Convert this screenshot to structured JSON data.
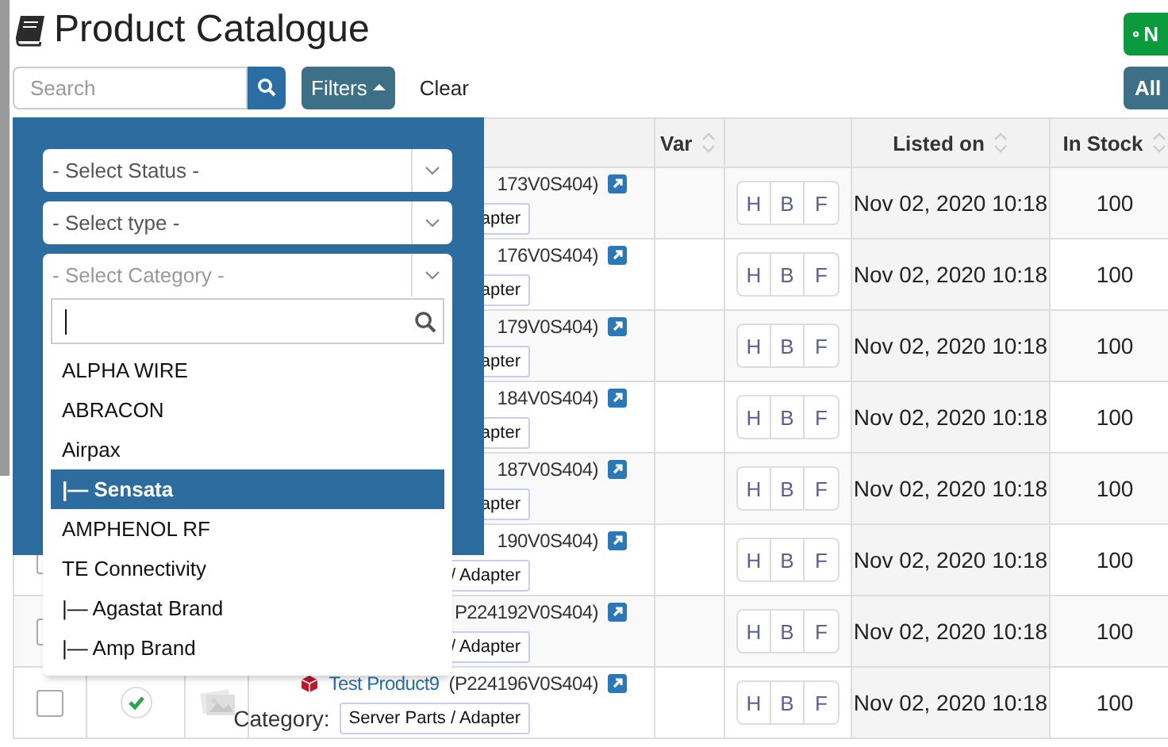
{
  "title": "Product Catalogue",
  "new_button": "N",
  "search": {
    "placeholder": "Search"
  },
  "filters_button": {
    "label": "Filters",
    "expanded": true
  },
  "clear_link": "Clear",
  "all_button": "All",
  "filter_panel": {
    "selects": [
      {
        "placeholder": "- Select Status -",
        "open": false
      },
      {
        "placeholder": "- Select type -",
        "open": false
      },
      {
        "placeholder": "- Select Category -",
        "open": true
      }
    ],
    "options": [
      {
        "label": "ALPHA WIRE",
        "selected": false
      },
      {
        "label": "ABRACON",
        "selected": false
      },
      {
        "label": "Airpax",
        "selected": false
      },
      {
        "label": "|— Sensata",
        "selected": true
      },
      {
        "label": "AMPHENOL RF",
        "selected": false
      },
      {
        "label": "TE Connectivity",
        "selected": false
      },
      {
        "label": "|— Agastat Brand",
        "selected": false
      },
      {
        "label": "|— Amp Brand",
        "selected": false
      }
    ]
  },
  "table": {
    "header": {
      "var": "Var",
      "listed_on": "Listed on",
      "in_stock": "In Stock"
    },
    "rows": [
      {
        "code": "173V0S404)",
        "category": "apter",
        "hbf": [
          "H",
          "B",
          "F"
        ],
        "listed_on": "Nov 02, 2020 10:18",
        "in_stock": "100"
      },
      {
        "code": "176V0S404)",
        "category": "apter",
        "hbf": [
          "H",
          "B",
          "F"
        ],
        "listed_on": "Nov 02, 2020 10:18",
        "in_stock": "100"
      },
      {
        "code": "179V0S404)",
        "category": "apter",
        "hbf": [
          "H",
          "B",
          "F"
        ],
        "listed_on": "Nov 02, 2020 10:18",
        "in_stock": "100"
      },
      {
        "code": "184V0S404)",
        "category": "apter",
        "hbf": [
          "H",
          "B",
          "F"
        ],
        "listed_on": "Nov 02, 2020 10:18",
        "in_stock": "100"
      },
      {
        "code": "187V0S404)",
        "category": "apter",
        "hbf": [
          "H",
          "B",
          "F"
        ],
        "listed_on": "Nov 02, 2020 10:18",
        "in_stock": "100"
      },
      {
        "checked": false,
        "code": "190V0S404)",
        "category": "/ Adapter",
        "hbf": [
          "H",
          "B",
          "F"
        ],
        "listed_on": "Nov 02, 2020 10:18",
        "in_stock": "100"
      },
      {
        "checked": false,
        "code": "P224192V0S404)",
        "category": "/ Adapter",
        "hbf": [
          "H",
          "B",
          "F"
        ],
        "listed_on": "Nov 02, 2020 10:18",
        "in_stock": "100"
      },
      {
        "checked": false,
        "approved": true,
        "name": "Test Product9",
        "code": "(P224196V0S404)",
        "category_label": "Category:",
        "category": "Server Parts / Adapter",
        "hbf": [
          "H",
          "B",
          "F"
        ],
        "listed_on": "Nov 02, 2020 10:18",
        "in_stock": "100"
      }
    ]
  }
}
